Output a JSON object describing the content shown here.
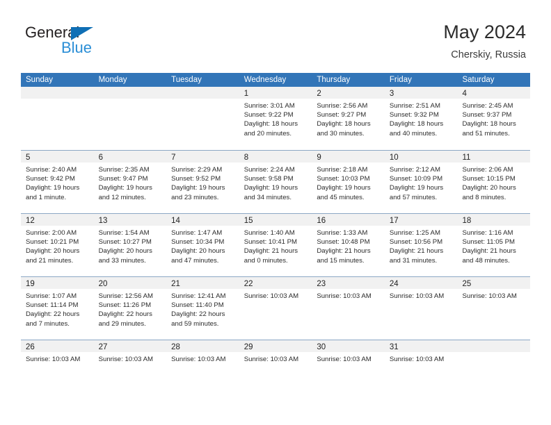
{
  "logo": {
    "text_primary": "General",
    "text_secondary": "Blue",
    "triangle_color": "#0f6fb5",
    "secondary_color": "#2a8ed6"
  },
  "header": {
    "title": "May 2024",
    "subtitle": "Cherskiy, Russia"
  },
  "colors": {
    "header_blue": "#3275b8",
    "daynum_band": "#f1f1f1",
    "row_divider": "#8ba7c4"
  },
  "weekdays": [
    "Sunday",
    "Monday",
    "Tuesday",
    "Wednesday",
    "Thursday",
    "Friday",
    "Saturday"
  ],
  "weeks": [
    [
      {
        "day": "",
        "lines": []
      },
      {
        "day": "",
        "lines": []
      },
      {
        "day": "",
        "lines": []
      },
      {
        "day": "1",
        "lines": [
          "Sunrise: 3:01 AM",
          "Sunset: 9:22 PM",
          "Daylight: 18 hours",
          "and 20 minutes."
        ]
      },
      {
        "day": "2",
        "lines": [
          "Sunrise: 2:56 AM",
          "Sunset: 9:27 PM",
          "Daylight: 18 hours",
          "and 30 minutes."
        ]
      },
      {
        "day": "3",
        "lines": [
          "Sunrise: 2:51 AM",
          "Sunset: 9:32 PM",
          "Daylight: 18 hours",
          "and 40 minutes."
        ]
      },
      {
        "day": "4",
        "lines": [
          "Sunrise: 2:45 AM",
          "Sunset: 9:37 PM",
          "Daylight: 18 hours",
          "and 51 minutes."
        ]
      }
    ],
    [
      {
        "day": "5",
        "lines": [
          "Sunrise: 2:40 AM",
          "Sunset: 9:42 PM",
          "Daylight: 19 hours",
          "and 1 minute."
        ]
      },
      {
        "day": "6",
        "lines": [
          "Sunrise: 2:35 AM",
          "Sunset: 9:47 PM",
          "Daylight: 19 hours",
          "and 12 minutes."
        ]
      },
      {
        "day": "7",
        "lines": [
          "Sunrise: 2:29 AM",
          "Sunset: 9:52 PM",
          "Daylight: 19 hours",
          "and 23 minutes."
        ]
      },
      {
        "day": "8",
        "lines": [
          "Sunrise: 2:24 AM",
          "Sunset: 9:58 PM",
          "Daylight: 19 hours",
          "and 34 minutes."
        ]
      },
      {
        "day": "9",
        "lines": [
          "Sunrise: 2:18 AM",
          "Sunset: 10:03 PM",
          "Daylight: 19 hours",
          "and 45 minutes."
        ]
      },
      {
        "day": "10",
        "lines": [
          "Sunrise: 2:12 AM",
          "Sunset: 10:09 PM",
          "Daylight: 19 hours",
          "and 57 minutes."
        ]
      },
      {
        "day": "11",
        "lines": [
          "Sunrise: 2:06 AM",
          "Sunset: 10:15 PM",
          "Daylight: 20 hours",
          "and 8 minutes."
        ]
      }
    ],
    [
      {
        "day": "12",
        "lines": [
          "Sunrise: 2:00 AM",
          "Sunset: 10:21 PM",
          "Daylight: 20 hours",
          "and 21 minutes."
        ]
      },
      {
        "day": "13",
        "lines": [
          "Sunrise: 1:54 AM",
          "Sunset: 10:27 PM",
          "Daylight: 20 hours",
          "and 33 minutes."
        ]
      },
      {
        "day": "14",
        "lines": [
          "Sunrise: 1:47 AM",
          "Sunset: 10:34 PM",
          "Daylight: 20 hours",
          "and 47 minutes."
        ]
      },
      {
        "day": "15",
        "lines": [
          "Sunrise: 1:40 AM",
          "Sunset: 10:41 PM",
          "Daylight: 21 hours",
          "and 0 minutes."
        ]
      },
      {
        "day": "16",
        "lines": [
          "Sunrise: 1:33 AM",
          "Sunset: 10:48 PM",
          "Daylight: 21 hours",
          "and 15 minutes."
        ]
      },
      {
        "day": "17",
        "lines": [
          "Sunrise: 1:25 AM",
          "Sunset: 10:56 PM",
          "Daylight: 21 hours",
          "and 31 minutes."
        ]
      },
      {
        "day": "18",
        "lines": [
          "Sunrise: 1:16 AM",
          "Sunset: 11:05 PM",
          "Daylight: 21 hours",
          "and 48 minutes."
        ]
      }
    ],
    [
      {
        "day": "19",
        "lines": [
          "Sunrise: 1:07 AM",
          "Sunset: 11:14 PM",
          "Daylight: 22 hours",
          "and 7 minutes."
        ]
      },
      {
        "day": "20",
        "lines": [
          "Sunrise: 12:56 AM",
          "Sunset: 11:26 PM",
          "Daylight: 22 hours",
          "and 29 minutes."
        ]
      },
      {
        "day": "21",
        "lines": [
          "Sunrise: 12:41 AM",
          "Sunset: 11:40 PM",
          "Daylight: 22 hours",
          "and 59 minutes."
        ]
      },
      {
        "day": "22",
        "lines": [
          "Sunrise: 10:03 AM"
        ]
      },
      {
        "day": "23",
        "lines": [
          "Sunrise: 10:03 AM"
        ]
      },
      {
        "day": "24",
        "lines": [
          "Sunrise: 10:03 AM"
        ]
      },
      {
        "day": "25",
        "lines": [
          "Sunrise: 10:03 AM"
        ]
      }
    ],
    [
      {
        "day": "26",
        "lines": [
          "Sunrise: 10:03 AM"
        ]
      },
      {
        "day": "27",
        "lines": [
          "Sunrise: 10:03 AM"
        ]
      },
      {
        "day": "28",
        "lines": [
          "Sunrise: 10:03 AM"
        ]
      },
      {
        "day": "29",
        "lines": [
          "Sunrise: 10:03 AM"
        ]
      },
      {
        "day": "30",
        "lines": [
          "Sunrise: 10:03 AM"
        ]
      },
      {
        "day": "31",
        "lines": [
          "Sunrise: 10:03 AM"
        ]
      },
      {
        "day": "",
        "lines": []
      }
    ]
  ]
}
